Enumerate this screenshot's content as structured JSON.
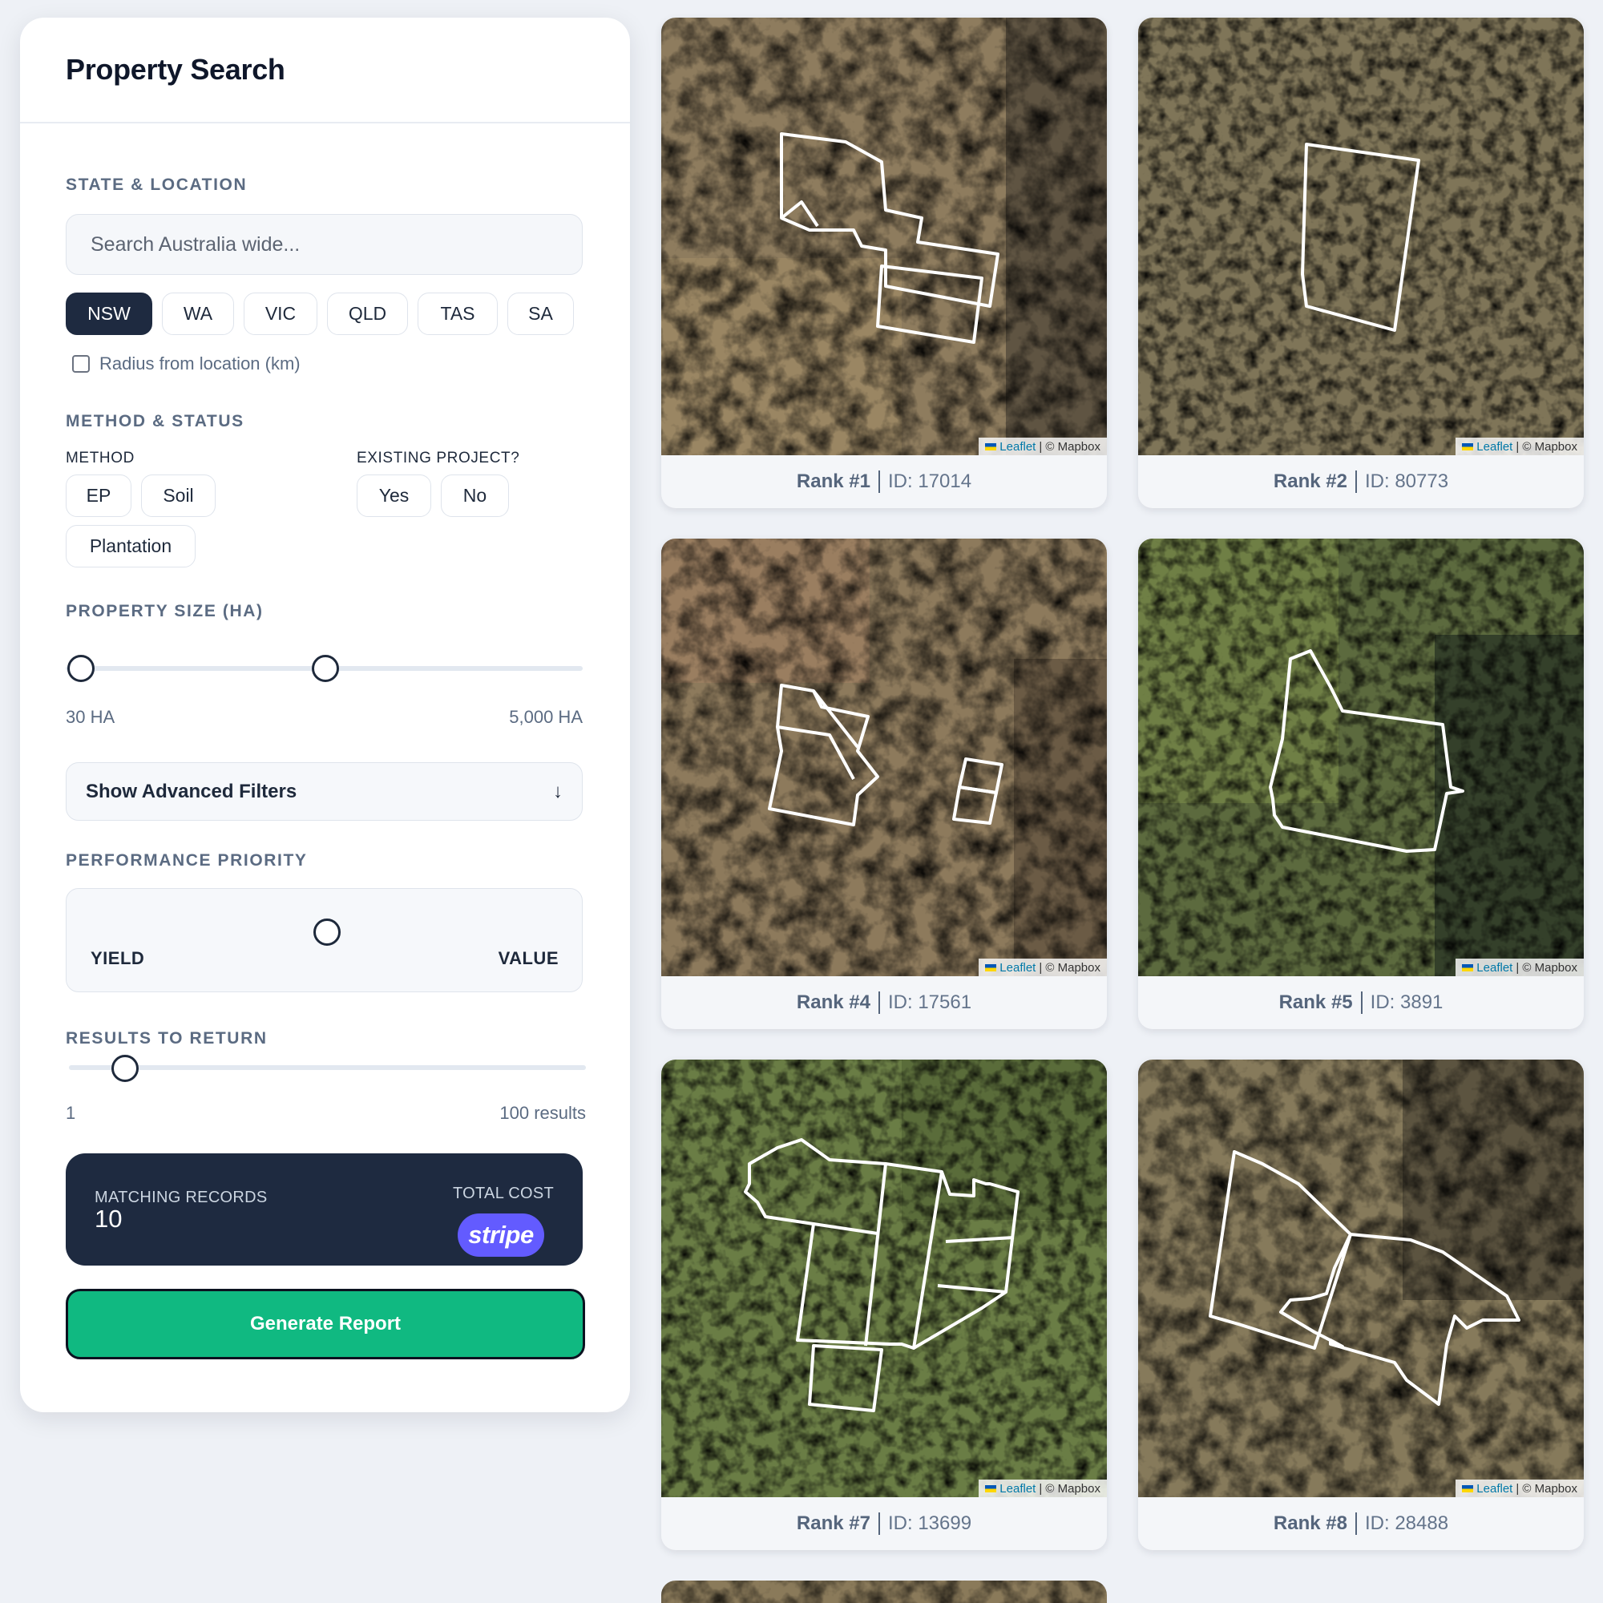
{
  "sidebar": {
    "title": "Property Search",
    "state_location": {
      "label": "STATE & LOCATION",
      "search_placeholder": "Search Australia wide...",
      "states": [
        "NSW",
        "WA",
        "VIC",
        "QLD",
        "TAS",
        "SA"
      ],
      "active_state": "NSW",
      "radius_label": "Radius from location (km)",
      "radius_checked": false
    },
    "method_status": {
      "label": "METHOD & STATUS",
      "method_label": "METHOD",
      "methods": [
        "EP",
        "Soil",
        "Plantation"
      ],
      "existing_label": "EXISTING PROJECT?",
      "existing_options": [
        "Yes",
        "No"
      ]
    },
    "property_size": {
      "label": "PROPERTY SIZE (HA)",
      "min_label": "30 HA",
      "max_label": "5,000 HA"
    },
    "advanced_filters": {
      "label": "Show Advanced Filters",
      "icon": "arrow-down-icon"
    },
    "performance_priority": {
      "label": "PERFORMANCE PRIORITY",
      "left": "YIELD",
      "right": "VALUE"
    },
    "results_to_return": {
      "label": "RESULTS TO RETURN",
      "min_label": "1",
      "max_label": "100 results"
    },
    "summary": {
      "matching_label": "MATCHING RECORDS",
      "matching_value": "10",
      "cost_label": "TOTAL COST",
      "payment_badge": "stripe"
    },
    "generate_button": "Generate Report"
  },
  "results": [
    {
      "rank": "Rank #1",
      "id": "ID: 17014"
    },
    {
      "rank": "Rank #2",
      "id": "ID: 80773"
    },
    {
      "rank": "Rank #4",
      "id": "ID: 17561"
    },
    {
      "rank": "Rank #5",
      "id": "ID: 3891"
    },
    {
      "rank": "Rank #7",
      "id": "ID: 13699"
    },
    {
      "rank": "Rank #8",
      "id": "ID: 28488"
    }
  ],
  "map_attribution": {
    "leaflet": "Leaflet",
    "provider": "| © Mapbox"
  },
  "colors": {
    "accent_dark": "#1e2a40",
    "generate_green": "#10b981",
    "stripe_purple": "#635bff"
  }
}
